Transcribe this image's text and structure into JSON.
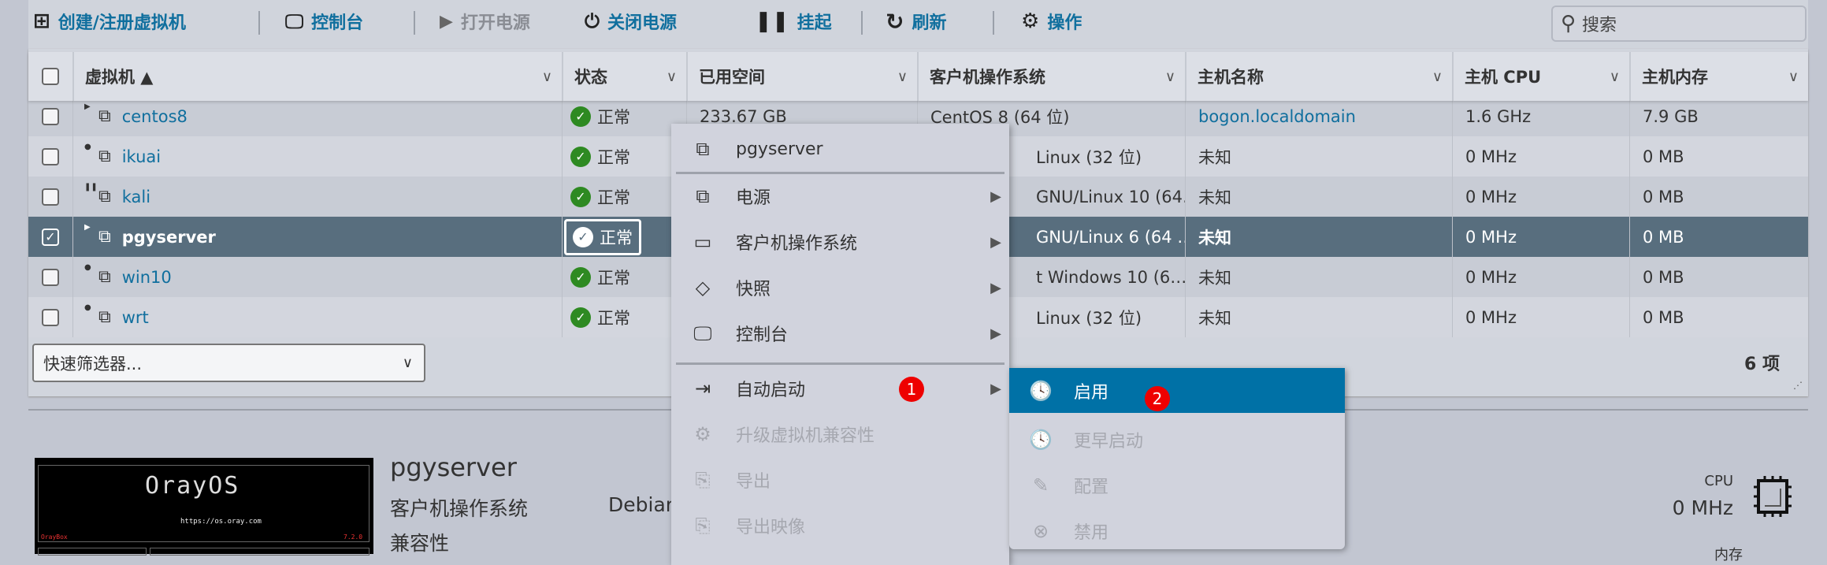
{
  "toolbar": {
    "create": "创建/注册虚拟机",
    "console": "控制台",
    "power_on": "打开电源",
    "power_off": "关闭电源",
    "suspend": "挂起",
    "refresh": "刷新",
    "actions": "操作",
    "search_placeholder": "搜索"
  },
  "table": {
    "columns": [
      "虚拟机 ▲",
      "状态",
      "已用空间",
      "客户机操作系统",
      "主机名称",
      "主机 CPU",
      "主机内存"
    ],
    "rows": [
      {
        "name": "centos8",
        "state": "running",
        "status": "正常",
        "used": "233.67 GB",
        "os": "CentOS 8 (64 位)",
        "host": "bogon.localdomain",
        "cpu": "1.6 GHz",
        "mem": "7.9 GB"
      },
      {
        "name": "ikuai",
        "state": "off",
        "status": "正常",
        "used": "",
        "os": "Linux (32 位)",
        "host": "未知",
        "cpu": "0 MHz",
        "mem": "0 MB"
      },
      {
        "name": "kali",
        "state": "paused",
        "status": "正常",
        "used": "",
        "os": "GNU/Linux 10 (64…",
        "host": "未知",
        "cpu": "0 MHz",
        "mem": "0 MB"
      },
      {
        "name": "pgyserver",
        "state": "running",
        "status": "正常",
        "used": "",
        "os": "GNU/Linux 6 (64 …",
        "host": "未知",
        "cpu": "0 MHz",
        "mem": "0 MB",
        "selected": true
      },
      {
        "name": "win10",
        "state": "off",
        "status": "正常",
        "used": "",
        "os": "t Windows 10 (6…",
        "host": "未知",
        "cpu": "0 MHz",
        "mem": "0 MB"
      },
      {
        "name": "wrt",
        "state": "off",
        "status": "正常",
        "used": "",
        "os": "Linux (32 位)",
        "host": "未知",
        "cpu": "0 MHz",
        "mem": "0 MB"
      }
    ],
    "filter_placeholder": "快速筛选器...",
    "count": "6 项"
  },
  "details": {
    "title": "pgyserver",
    "os_label": "客户机操作系统",
    "os_value": "Debian",
    "compat_label": "兼容性",
    "cpu_label": "CPU",
    "cpu_value": "0 MHz",
    "mem_label": "内存",
    "thumb_url": "https://os.oray.com",
    "thumb_brand": "OrayBox",
    "thumb_version": "7.2.0",
    "thumb_logo": "OrayOS"
  },
  "context_menu": {
    "header": "pgyserver",
    "items": [
      {
        "label": "电源",
        "icon": "power-vm-icon",
        "submenu": true
      },
      {
        "label": "客户机操作系统",
        "icon": "window-icon",
        "submenu": true
      },
      {
        "label": "快照",
        "icon": "tag-icon",
        "submenu": true
      },
      {
        "label": "控制台",
        "icon": "monitor-icon",
        "submenu": true
      },
      {
        "label": "自动启动",
        "icon": "autostart-icon",
        "submenu": true
      },
      {
        "label": "升级虚拟机兼容性",
        "icon": "gear-icon",
        "disabled": true
      },
      {
        "label": "导出",
        "icon": "export-icon",
        "disabled": true
      },
      {
        "label": "导出映像",
        "icon": "export-image-icon",
        "disabled": true
      }
    ]
  },
  "submenu": {
    "items": [
      {
        "label": "启用",
        "highlighted": true
      },
      {
        "label": "更早启动",
        "disabled": true
      },
      {
        "label": "配置",
        "disabled": true
      },
      {
        "label": "禁用",
        "disabled": true
      }
    ]
  },
  "badges": [
    "1",
    "2"
  ],
  "colors": {
    "accent": "#0071a6",
    "selected_row": "#586e7e",
    "status_ok": "#2e8a22",
    "badge": "#ee0000"
  }
}
